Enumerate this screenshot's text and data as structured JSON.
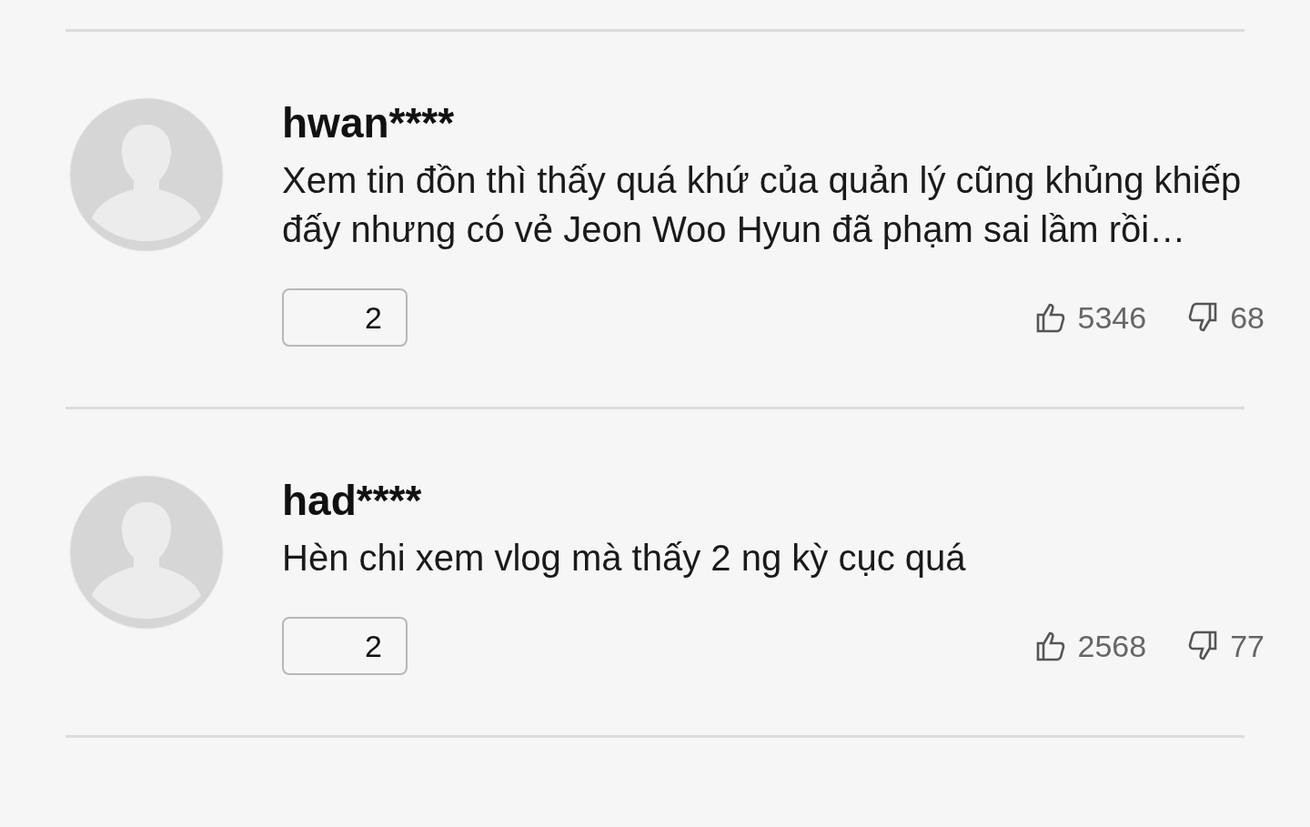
{
  "comments": [
    {
      "user": "hwan****",
      "text": "Xem tin đồn thì thấy quá khứ của quản lý cũng khủng khiếp đấy nhưng có vẻ Jeon Woo Hyun đã phạm sai lầm rồi…",
      "replies": "2",
      "likes": "5346",
      "dislikes": "68"
    },
    {
      "user": "had****",
      "text": "Hèn chi xem vlog mà thấy 2 ng kỳ cục quá",
      "replies": "2",
      "likes": "2568",
      "dislikes": "77"
    }
  ]
}
